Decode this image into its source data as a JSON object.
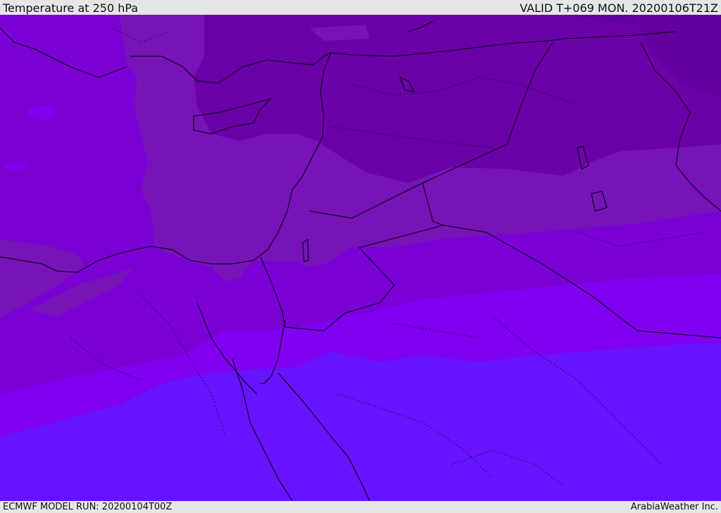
{
  "header": {
    "title": "Temperature at 250 hPa",
    "valid": "VALID T+069 MON. 20200106T21Z"
  },
  "footer": {
    "model_run": "ECMWF MODEL RUN: 20200104T00Z",
    "credit": "ArabiaWeather Inc."
  },
  "map": {
    "variable": "temperature",
    "level": "250 hPa",
    "shading_colors": {
      "coldest": "#5f009e",
      "colder": "#6a00a8",
      "cold": "#7614b8",
      "mid": "#7a00d6",
      "warm": "#8000f0",
      "warmest": "#6614ff"
    },
    "boundary_color": "#000000"
  }
}
